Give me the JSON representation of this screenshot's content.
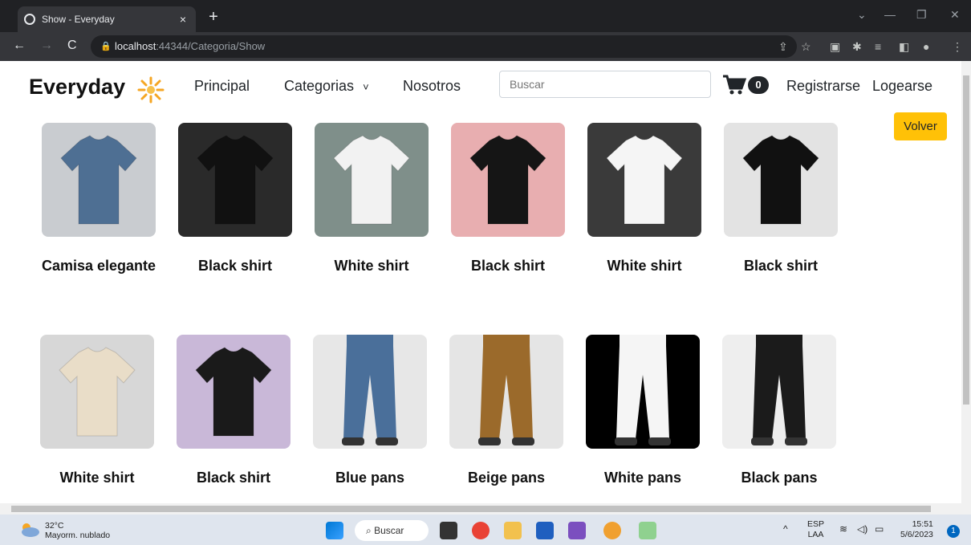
{
  "browser": {
    "tab_title": "Show - Everyday",
    "tab_close": "×",
    "new_tab": "+",
    "url_host": "localhost",
    "url_rest": ":44344/Categoria/Show"
  },
  "navbar": {
    "brand": "Everyday",
    "links": [
      "Principal",
      "Categorias",
      "Nosotros"
    ],
    "dropdown_caret": "˅",
    "search_placeholder": "Buscar",
    "cart_count": "0",
    "register": "Registrarse",
    "login": "Logearse"
  },
  "back_button": "Volver",
  "products": [
    {
      "name": "Camisa elegante",
      "color": "#9fb3c8",
      "shirt": "#4e6f93",
      "bg": "#c9ccd0"
    },
    {
      "name": "Black shirt",
      "color": "#222",
      "shirt": "#111",
      "bg": "#2a2a2a"
    },
    {
      "name": "White shirt",
      "color": "#e9ecef",
      "shirt": "#f2f2f2",
      "bg": "#7f8f8a"
    },
    {
      "name": "Black shirt",
      "color": "#111",
      "shirt": "#151515",
      "bg": "#e8aeb0"
    },
    {
      "name": "White shirt",
      "color": "#fff",
      "shirt": "#f5f5f5",
      "bg": "#3a3a3a"
    },
    {
      "name": "Black shirt",
      "color": "#111",
      "shirt": "#111",
      "bg": "#e3e3e3"
    },
    {
      "name": "White shirt",
      "color": "#e6dccd",
      "shirt": "#e9ddc8",
      "bg": "#d7d7d7"
    },
    {
      "name": "Black shirt",
      "color": "#111",
      "shirt": "#1a1a1a",
      "bg": "#c9b8d8"
    },
    {
      "name": "Blue pans",
      "color": "#3b5f8a",
      "shirt": "#4a6f9a",
      "bg": "#e7e7e7"
    },
    {
      "name": "Beige pans",
      "color": "#9c6c2a",
      "shirt": "#9b6a2b",
      "bg": "#e5e5e5"
    },
    {
      "name": "White pans",
      "color": "#fff",
      "shirt": "#f5f5f5",
      "bg": "#000000"
    },
    {
      "name": "Black pans",
      "color": "#1b1b1b",
      "shirt": "#1b1b1b",
      "bg": "#eeeeee"
    }
  ],
  "taskbar": {
    "temp": "32°C",
    "weather": "Mayorm. nublado",
    "search": "Buscar",
    "lang1": "ESP",
    "lang2": "LAA",
    "time": "15:51",
    "date": "5/6/2023",
    "notifications": "1"
  }
}
